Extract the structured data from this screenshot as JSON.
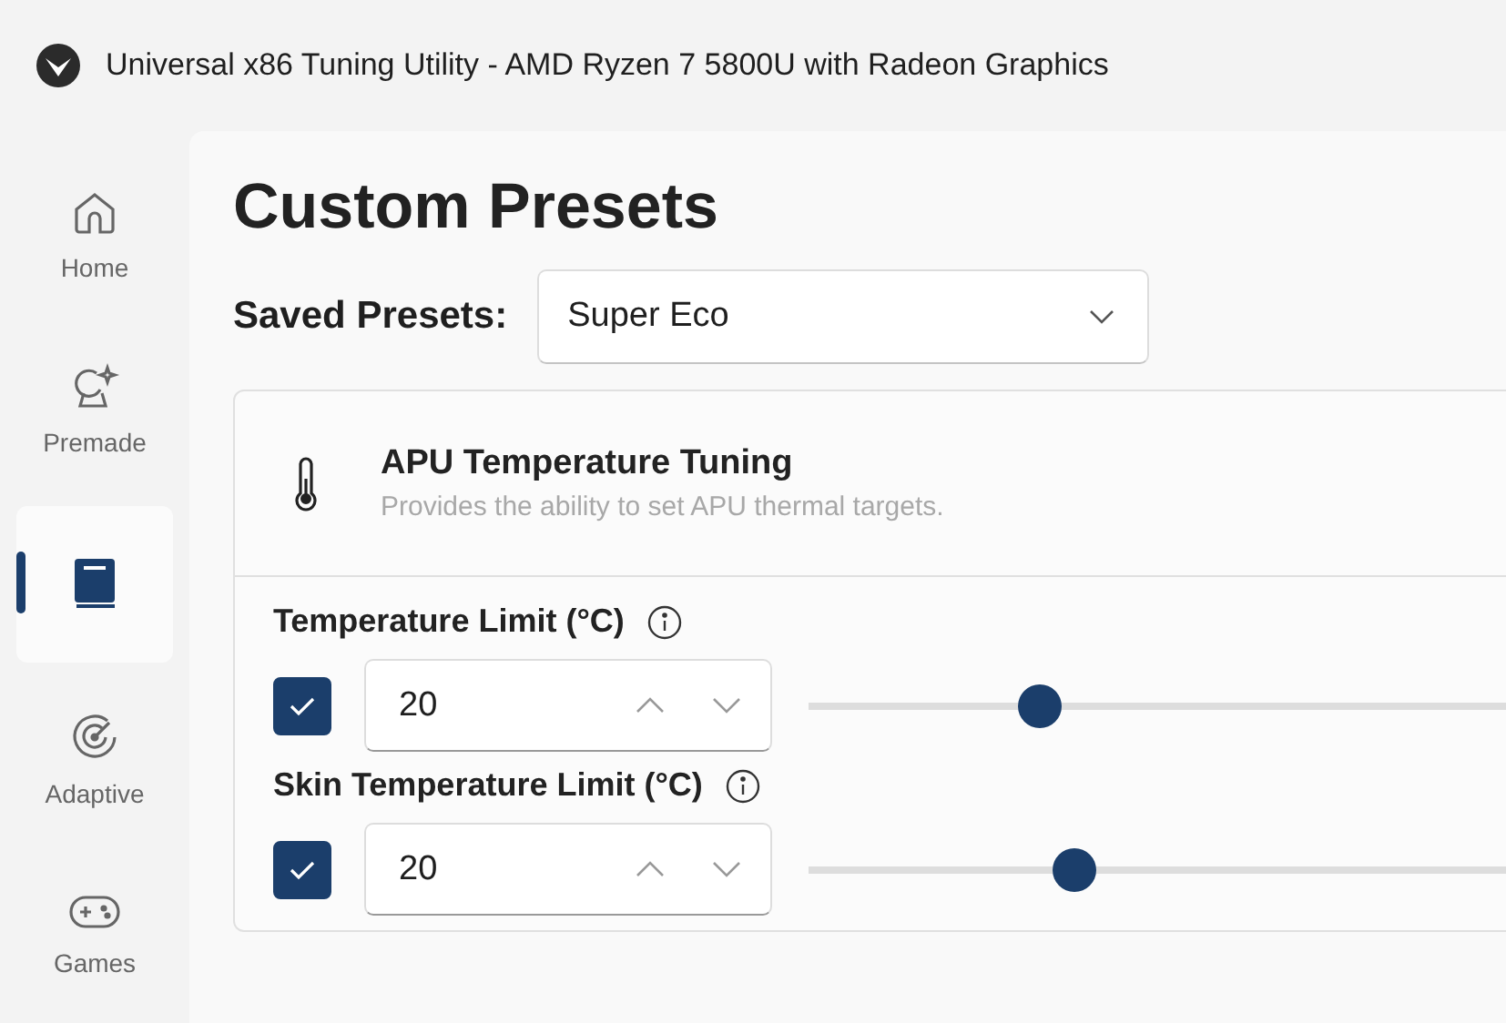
{
  "window": {
    "title": "Universal x86 Tuning Utility - AMD Ryzen 7 5800U with Radeon Graphics"
  },
  "sidebar": {
    "items": [
      {
        "kind": "home",
        "label": "Home",
        "selected": false
      },
      {
        "kind": "premade",
        "label": "Premade",
        "selected": false
      },
      {
        "kind": "book",
        "selected": true
      },
      {
        "kind": "adaptive",
        "label": "Adaptive",
        "selected": false
      },
      {
        "kind": "games",
        "label": "Games",
        "selected": false
      }
    ]
  },
  "page": {
    "title": "Custom Presets",
    "saved_presets": {
      "label": "Saved Presets:",
      "value": "Super Eco"
    }
  },
  "card": {
    "title": "APU Temperature Tuning",
    "subtitle": "Provides the ability to set APU thermal targets.",
    "settings": [
      {
        "label": "Temperature Limit (°C)",
        "checked": true,
        "value": "20",
        "level": 0.33
      },
      {
        "label": "Skin Temperature Limit (°C)",
        "checked": true,
        "value": "20",
        "level": 0.38
      }
    ]
  }
}
